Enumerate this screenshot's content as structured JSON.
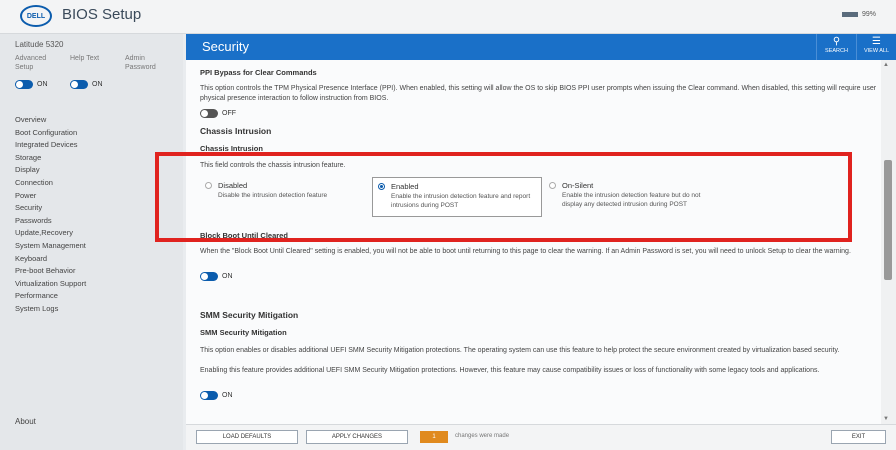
{
  "app": {
    "title": "BIOS Setup",
    "logo": "DELL",
    "battery": "99%"
  },
  "sidebar": {
    "model": "Latitude 5320",
    "modes": [
      {
        "label": "Advanced\nSetup",
        "state": "ON"
      },
      {
        "label": "Help Text",
        "state": "ON"
      },
      {
        "label": "Admin\nPassword"
      }
    ],
    "items": [
      {
        "label": "Overview"
      },
      {
        "label": "Boot Configuration"
      },
      {
        "label": "Integrated Devices"
      },
      {
        "label": "Storage"
      },
      {
        "label": "Display"
      },
      {
        "label": "Connection"
      },
      {
        "label": "Power"
      },
      {
        "label": "Security"
      },
      {
        "label": "Passwords"
      },
      {
        "label": "Update,Recovery"
      },
      {
        "label": "System Management"
      },
      {
        "label": "Keyboard"
      },
      {
        "label": "Pre-boot Behavior"
      },
      {
        "label": "Virtualization Support"
      },
      {
        "label": "Performance"
      },
      {
        "label": "System Logs"
      }
    ],
    "about": "About"
  },
  "header": {
    "title": "Security",
    "search": "SEARCH",
    "view_all": "VIEW ALL"
  },
  "content": {
    "ppi_title": "PPI Bypass for Clear Commands",
    "ppi_desc": "This option controls the TPM Physical Presence Interface (PPI). When enabled, this setting will allow the OS to skip BIOS PPI user prompts when issuing the Clear command. When disabled, this setting will require user physical presence interaction to follow instruction from BIOS.",
    "ppi_state": "OFF",
    "chassis_section": "Chassis Intrusion",
    "chassis_sub": "Chassis Intrusion",
    "chassis_desc": "This field controls the chassis intrusion feature.",
    "chassis_options": [
      {
        "title": "Disabled",
        "desc": "Disable the intrusion detection feature",
        "selected": false
      },
      {
        "title": "Enabled",
        "desc": "Enable the intrusion detection feature and report intrusions during POST",
        "selected": true
      },
      {
        "title": "On-Silent",
        "desc": "Enable the intrusion detection feature but do not display any detected intrusion during POST",
        "selected": false
      }
    ],
    "block_title": "Block Boot Until Cleared",
    "block_desc": "When the \"Block Boot Until Cleared\" setting is enabled, you will not be able to boot until returning to this page to clear the warning. If an Admin Password is set, you will need to unlock Setup to clear the warning.",
    "block_state": "ON",
    "smm_section": "SMM Security Mitigation",
    "smm_sub": "SMM Security Mitigation",
    "smm_desc1": "This option enables or disables additional UEFI SMM Security Mitigation protections. The operating system can use this feature to help protect the secure environment created by virtualization based security.",
    "smm_desc2": "Enabling this feature provides additional UEFI SMM Security Mitigation protections. However, this feature may cause compatibility issues or loss of functionality with some legacy tools and applications.",
    "smm_state": "ON"
  },
  "footer": {
    "load_defaults": "LOAD DEFAULTS",
    "apply_changes": "APPLY CHANGES",
    "changes_count": "1",
    "changes_note": "changes were made",
    "exit": "EXIT"
  },
  "colors": {
    "accent": "#1a70c8",
    "highlight": "#e0231f",
    "badge": "#e08a1e"
  }
}
